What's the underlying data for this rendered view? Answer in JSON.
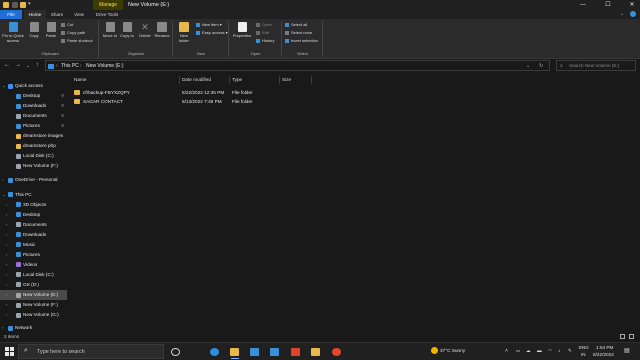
{
  "window": {
    "title": "New Volume (E:)",
    "manage_tab": "Manage",
    "minimize": "—",
    "maximize": "☐",
    "close": "✕"
  },
  "ribbon_tabs": [
    "File",
    "Home",
    "Share",
    "View",
    "Drive Tools"
  ],
  "ribbon": {
    "clipboard": {
      "pin_to_quick_access": "Pin to Quick access",
      "copy": "Copy",
      "paste": "Paste",
      "cut": "Cut",
      "copy_path": "Copy path",
      "paste_shortcut": "Paste shortcut",
      "label": "Clipboard"
    },
    "organize": {
      "move_to": "Move to",
      "copy_to": "Copy to",
      "delete": "Delete",
      "rename": "Rename",
      "label": "Organize"
    },
    "new": {
      "new_folder": "New folder",
      "new_item": "New item",
      "easy_access": "Easy access",
      "label": "New"
    },
    "open": {
      "properties": "Properties",
      "open": "Open",
      "edit": "Edit",
      "history": "History",
      "label": "Open"
    },
    "select": {
      "select_all": "Select all",
      "select_none": "Select none",
      "invert_selection": "Invert selection",
      "label": "Select"
    }
  },
  "address": {
    "crumbs": [
      "This PC",
      "New Volume (E:)"
    ],
    "search_placeholder": "Search New Volume (E:)"
  },
  "nav": {
    "items": [
      {
        "label": "Quick access",
        "level": 0,
        "icon": "star-icon",
        "color": "#3c8ee8"
      },
      {
        "label": "Desktop",
        "level": 1,
        "icon": "desktop-icon",
        "color": "#3a8fd9",
        "pinned": true
      },
      {
        "label": "Downloads",
        "level": 1,
        "icon": "download-icon",
        "color": "#3a8fd9",
        "pinned": true
      },
      {
        "label": "Documents",
        "level": 1,
        "icon": "document-icon",
        "color": "#9aa4b0",
        "pinned": true
      },
      {
        "label": "Pictures",
        "level": 1,
        "icon": "picture-icon",
        "color": "#3a8fd9",
        "pinned": true
      },
      {
        "label": "dreamstore images",
        "level": 1,
        "icon": "folder-icon",
        "color": "#e8b84a"
      },
      {
        "label": "dreamstore php",
        "level": 1,
        "icon": "folder-icon",
        "color": "#e8b84a"
      },
      {
        "label": "Local Disk (C:)",
        "level": 1,
        "icon": "drive-icon",
        "color": "#9aa4b0"
      },
      {
        "label": "New Volume (F:)",
        "level": 1,
        "icon": "drive-icon",
        "color": "#9aa4b0"
      },
      {
        "label": "OneDrive - Personal",
        "level": 0,
        "icon": "cloud-icon",
        "color": "#3a8fd9"
      },
      {
        "label": "This PC",
        "level": 0,
        "icon": "computer-icon",
        "color": "#3a8fd9"
      },
      {
        "label": "3D Objects",
        "level": 1,
        "icon": "cube-icon",
        "color": "#3a8fd9"
      },
      {
        "label": "Desktop",
        "level": 1,
        "icon": "desktop-icon",
        "color": "#3a8fd9"
      },
      {
        "label": "Documents",
        "level": 1,
        "icon": "document-icon",
        "color": "#9aa4b0"
      },
      {
        "label": "Downloads",
        "level": 1,
        "icon": "download-icon",
        "color": "#3a8fd9"
      },
      {
        "label": "Music",
        "level": 1,
        "icon": "music-icon",
        "color": "#3a8fd9"
      },
      {
        "label": "Pictures",
        "level": 1,
        "icon": "picture-icon",
        "color": "#3a8fd9"
      },
      {
        "label": "Videos",
        "level": 1,
        "icon": "video-icon",
        "color": "#9b6fd6"
      },
      {
        "label": "Local Disk (C:)",
        "level": 1,
        "icon": "drive-icon",
        "color": "#9aa4b0"
      },
      {
        "label": "OS (D:)",
        "level": 1,
        "icon": "drive-icon",
        "color": "#9aa4b0"
      },
      {
        "label": "New Volume (E:)",
        "level": 1,
        "icon": "drive-icon",
        "color": "#9aa4b0",
        "selected": true
      },
      {
        "label": "New Volume (F:)",
        "level": 1,
        "icon": "drive-icon",
        "color": "#9aa4b0"
      },
      {
        "label": "New Volume (G:)",
        "level": 1,
        "icon": "drive-icon",
        "color": "#9aa4b0"
      },
      {
        "label": "Network",
        "level": 0,
        "icon": "network-icon",
        "color": "#3a8fd9"
      }
    ]
  },
  "file_list": {
    "columns": [
      "Name",
      "Date modified",
      "Type",
      "Size"
    ],
    "rows": [
      {
        "name": "cfrbackup-FBYXZQPY",
        "date": "5/22/2022 12:35 PM",
        "type": "File folder",
        "size": ""
      },
      {
        "name": "SAGAR CONTACT",
        "date": "5/13/2022 7:49 PM",
        "type": "File folder",
        "size": ""
      }
    ]
  },
  "status": {
    "item_count": "2 items"
  },
  "taskbar": {
    "search_placeholder": "Type here to search",
    "apps": [
      {
        "name": "task-view-icon",
        "color": "#d0d0d0"
      },
      {
        "name": "edge-icon",
        "color": "#2b8fe0"
      },
      {
        "name": "file-explorer-icon",
        "color": "#e8b84a"
      },
      {
        "name": "store-icon",
        "color": "#3a8fd9"
      },
      {
        "name": "mail-icon",
        "color": "#3a8fd9"
      },
      {
        "name": "office-icon",
        "color": "#e0452c"
      },
      {
        "name": "explorer-alt-icon",
        "color": "#e8b84a"
      },
      {
        "name": "chrome-icon",
        "color": "#e8452c"
      }
    ],
    "weather": "37°C  Sunny",
    "language": "ENG",
    "region": "IN",
    "time": "1:04 PM",
    "date": "5/22/2022"
  }
}
